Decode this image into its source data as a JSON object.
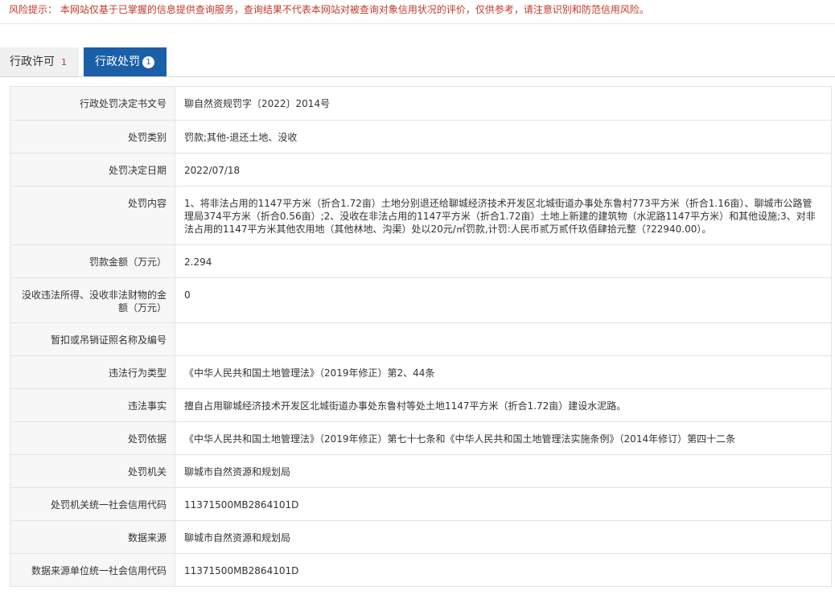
{
  "risk_notice": "风险提示： 本网站仅基于已掌握的信息提供查询服务，查询结果不代表本网站对被查询对象信用状况的评价，仅供参考，请注意识别和防范信用风险。",
  "tabs": [
    {
      "label": "行政许可",
      "count": "1"
    },
    {
      "label": "行政处罚",
      "count": "1"
    }
  ],
  "rows": [
    {
      "label": "行政处罚决定书文号",
      "value": "聊自然资规罚字〔2022〕2014号"
    },
    {
      "label": "处罚类别",
      "value": "罚款;其他-退还土地、没收"
    },
    {
      "label": "处罚决定日期",
      "value": "2022/07/18"
    },
    {
      "label": "处罚内容",
      "value": "1、将非法占用的1147平方米（折合1.72亩）土地分别退还给聊城经济技术开发区北城街道办事处东鲁村773平方米（折合1.16亩）、聊城市公路管理局374平方米（折合0.56亩）;2、没收在非法占用的1147平方米（折合1.72亩）土地上新建的建筑物（水泥路1147平方米）和其他设施;3、对非法占用的1147平方米其他农用地（其他林地、沟渠）处以20元/㎡罚款,计罚:人民币贰万贰仟玖佰肆拾元整（?22940.00）。"
    },
    {
      "label": "罚款金额（万元）",
      "value": "2.294"
    },
    {
      "label": "没收违法所得、没收非法财物的金额（万元）",
      "value": "0"
    },
    {
      "label": "暂扣或吊销证照名称及编号",
      "value": ""
    },
    {
      "label": "违法行为类型",
      "value": "《中华人民共和国土地管理法》（2019年修正）第2、44条"
    },
    {
      "label": "违法事实",
      "value": "擅自占用聊城经济技术开发区北城街道办事处东鲁村等处土地1147平方米（折合1.72亩）建设水泥路。"
    },
    {
      "label": "处罚依据",
      "value": "《中华人民共和国土地管理法》（2019年修正）第七十七条和《中华人民共和国土地管理法实施条例》（2014年修订）第四十二条"
    },
    {
      "label": "处罚机关",
      "value": "聊城市自然资源和规划局"
    },
    {
      "label": "处罚机关统一社会信用代码",
      "value": "11371500MB2864101D"
    },
    {
      "label": "数据来源",
      "value": "聊城市自然资源和规划局"
    },
    {
      "label": "数据来源单位统一社会信用代码",
      "value": "11371500MB2864101D"
    }
  ]
}
